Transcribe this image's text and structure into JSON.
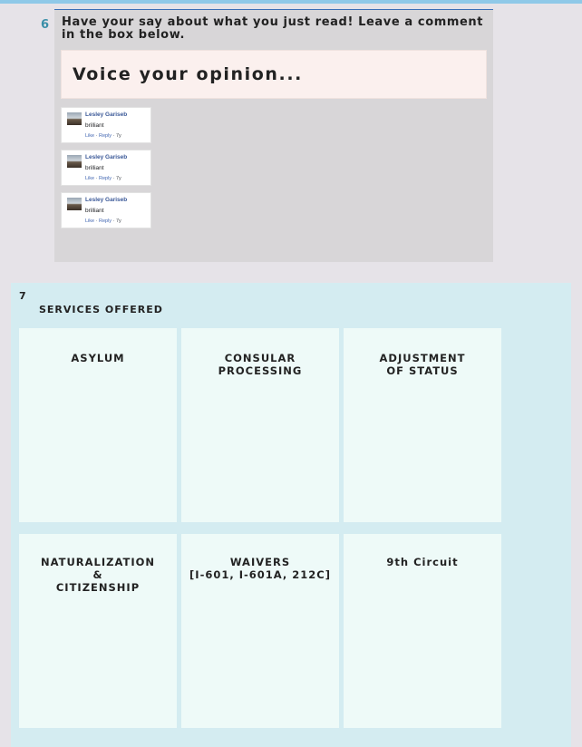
{
  "section6": {
    "number": "6",
    "prompt": "Have your say about what you just read! Leave a comment in the box below.",
    "opinion_placeholder": "Voice your opinion...",
    "comments": [
      {
        "author": "Lesley Gariseb",
        "text": "brilliant",
        "like": "Like",
        "reply": "Reply",
        "age": "7y"
      },
      {
        "author": "Lesley Gariseb",
        "text": "brilliant",
        "like": "Like",
        "reply": "Reply",
        "age": "7y"
      },
      {
        "author": "Lesley Gariseb",
        "text": "brilliant",
        "like": "Like",
        "reply": "Reply",
        "age": "7y"
      }
    ]
  },
  "section7": {
    "number": "7",
    "title": "SERVICES OFFERED",
    "tiles": [
      "ASYLUM",
      "CONSULAR PROCESSING",
      "ADJUSTMENT\nOF STATUS",
      "NATURALIZATION\n&\nCITIZENSHIP",
      "WAIVERS\n[I-601, I-601A, 212C]",
      "9th Circuit"
    ]
  },
  "colors": {
    "accent_rule": "#3b6fb6",
    "number_teal": "#3a8fa8",
    "services_bg": "#d4ecf1",
    "tile_bg": "#eefaf8",
    "opinion_bg": "#fbf0ee"
  }
}
